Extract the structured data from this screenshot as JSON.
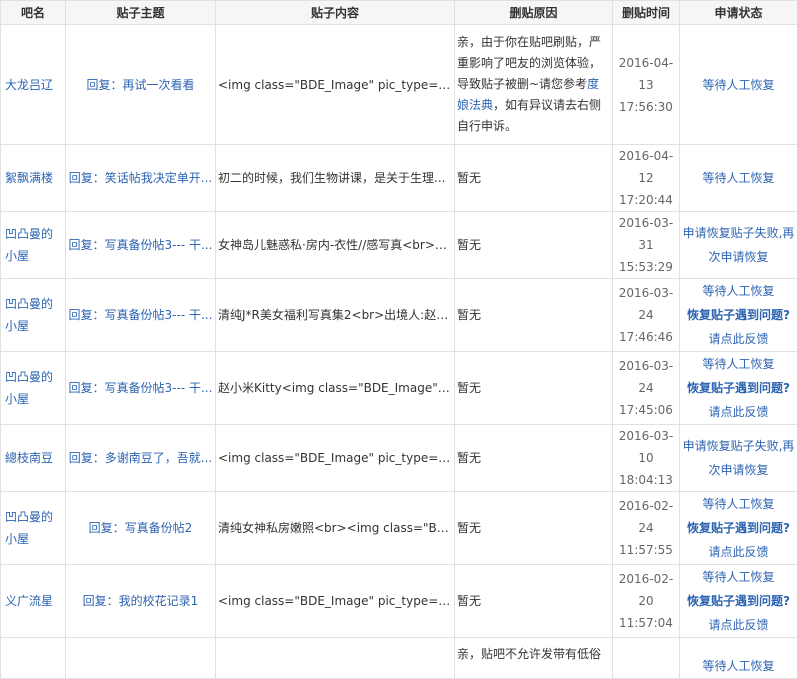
{
  "headers": {
    "forum": "吧名",
    "topic": "贴子主题",
    "content": "贴子内容",
    "reason": "删贴原因",
    "time": "删贴时间",
    "status": "申请状态"
  },
  "rows": [
    {
      "forum": "大龙吕辽",
      "topic": "回复：再试一次看看",
      "content": "<img class=\"BDE_Image\" pic_type=\"1\" w...",
      "reason_before": "亲，由于你在贴吧刷贴，严重影响了吧友的浏览体验，导致贴子被删~请您参考",
      "reason_link": "度娘法典",
      "reason_after": "，如有异议请去右侧自行申诉。",
      "date": "2016-04-13",
      "clock": "17:56:30",
      "status1": "等待人工恢复",
      "status2": "",
      "status3": ""
    },
    {
      "forum": "絮飘满楼",
      "topic": "回复：笑话帖我决定单开...",
      "content": "初二的时候，我们生物讲课，是关于生理...",
      "reason_before": "暂无",
      "reason_link": "",
      "reason_after": "",
      "date": "2016-04-12",
      "clock": "17:20:44",
      "status1": "等待人工恢复",
      "status2": "",
      "status3": ""
    },
    {
      "forum": "凹凸曼的小屋",
      "topic": "回复：写真备份帖3--- 干...",
      "content": "女神岛儿魅惑私·房内-衣性//感写真<br><i...",
      "reason_before": "暂无",
      "reason_link": "",
      "reason_after": "",
      "date": "2016-03-31",
      "clock": "15:53:29",
      "status1": "申请恢复贴子失败,再次申请恢复",
      "status2": "",
      "status3": ""
    },
    {
      "forum": "凹凸曼的小屋",
      "topic": "回复：写真备份帖3--- 干...",
      "content": "清纯J*R美女福利写真集2<br>出境人:赵小...",
      "reason_before": "暂无",
      "reason_link": "",
      "reason_after": "",
      "date": "2016-03-24",
      "clock": "17:46:46",
      "status1": "等待人工恢复",
      "status2": "恢复贴子遇到问题?",
      "status3": "请点此反馈"
    },
    {
      "forum": "凹凸曼的小屋",
      "topic": "回复：写真备份帖3--- 干...",
      "content": "赵小米Kitty<img class=\"BDE_Image\" pic...",
      "reason_before": "暂无",
      "reason_link": "",
      "reason_after": "",
      "date": "2016-03-24",
      "clock": "17:45:06",
      "status1": "等待人工恢复",
      "status2": "恢复贴子遇到问题?",
      "status3": "请点此反馈"
    },
    {
      "forum": "總枝南豆",
      "topic": "回复：多谢南豆了，吾就...",
      "content": "<img class=\"BDE_Image\" pic_type=\"1\" w...",
      "reason_before": "暂无",
      "reason_link": "",
      "reason_after": "",
      "date": "2016-03-10",
      "clock": "18:04:13",
      "status1": "申请恢复贴子失败,再次申请恢复",
      "status2": "",
      "status3": ""
    },
    {
      "forum": "凹凸曼的小屋",
      "topic": "回复：写真备份帖2",
      "content": "清纯女神私房嫩照<br><img class=\"BDE_...",
      "reason_before": "暂无",
      "reason_link": "",
      "reason_after": "",
      "date": "2016-02-24",
      "clock": "11:57:55",
      "status1": "等待人工恢复",
      "status2": "恢复贴子遇到问题?",
      "status3": "请点此反馈"
    },
    {
      "forum": "义广流星",
      "topic": "回复：我的校花记录1",
      "content": "<img class=\"BDE_Image\" pic_type=\"1\" w...",
      "reason_before": "暂无",
      "reason_link": "",
      "reason_after": "",
      "date": "2016-02-20",
      "clock": "11:57:04",
      "status1": "等待人工恢复",
      "status2": "恢复贴子遇到问题?",
      "status3": "请点此反馈"
    },
    {
      "forum": "",
      "topic": "",
      "content": "",
      "reason_before": "亲，贴吧不允许发带有低俗",
      "reason_link": "",
      "reason_after": "",
      "date": "",
      "clock": "",
      "status1": "等待人工恢复",
      "status2": "",
      "status3": ""
    }
  ]
}
